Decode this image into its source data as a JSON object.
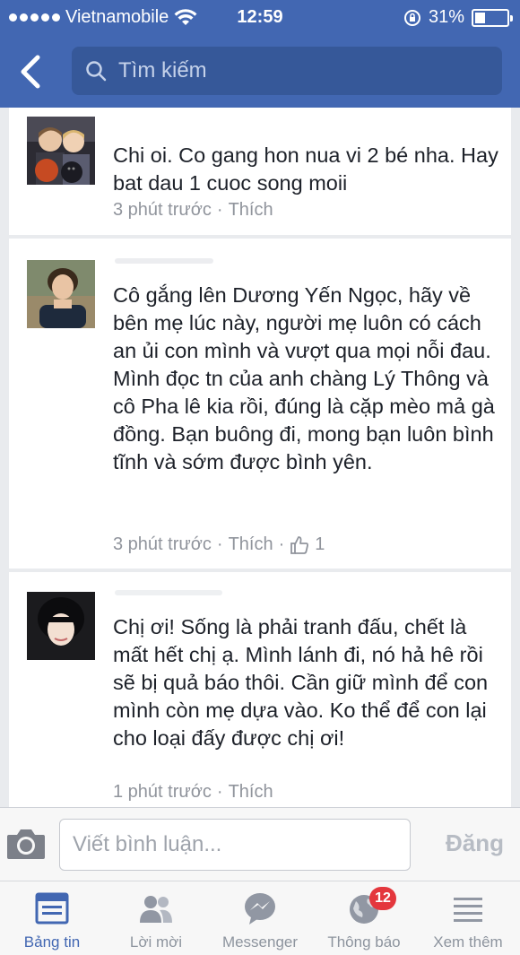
{
  "status_bar": {
    "carrier": "Vietnamobile",
    "time": "12:59",
    "battery_text": "31%",
    "battery_level": 0.31
  },
  "nav": {
    "back_icon": "chevron-left-icon",
    "search_placeholder": "Tìm kiếm"
  },
  "comments": [
    {
      "text": "Chi oi. Co gang hon nua vi 2 bé nha. Hay bat dau 1 cuoc song moii",
      "time": "3 phút trước",
      "like_label": "Thích",
      "likes": ""
    },
    {
      "text": "Cô gắng lên Dương Yến Ngọc, hãy về bên mẹ lúc này, người mẹ luôn có cách an ủi con mình và vượt qua mọi nỗi đau. Mình đọc tn của anh chàng Lý Thông và cô Pha lê kia rồi, đúng là cặp mèo mả gà đồng. Bạn buông đi, mong bạn luôn bình tĩnh và sớm được bình yên.",
      "time": "3 phút trước",
      "like_label": "Thích",
      "likes": "1"
    },
    {
      "text": "Chị ơi! Sống là phải tranh đấu, chết là mất hết chị ạ. Mình lánh đi, nó hả hê rồi sẽ bị quả báo thôi. Cần giữ mình để con mình còn mẹ dựa vào. Ko thể để con lại cho loại  đấy được chị ơi!",
      "time": "1 phút trước",
      "like_label": "Thích",
      "likes": ""
    }
  ],
  "composer": {
    "placeholder": "Viết bình luận...",
    "post_label": "Đăng"
  },
  "tabs": [
    {
      "label": "Bảng tin",
      "icon": "news-feed-icon",
      "active": true
    },
    {
      "label": "Lời mời",
      "icon": "friend-requests-icon",
      "active": false
    },
    {
      "label": "Messenger",
      "icon": "messenger-icon",
      "active": false
    },
    {
      "label": "Thông báo",
      "icon": "globe-icon",
      "active": false,
      "badge": "12"
    },
    {
      "label": "Xem thêm",
      "icon": "menu-icon",
      "active": false
    }
  ],
  "colors": {
    "brand": "#4267b2",
    "meta_gray": "#90949c",
    "badge_red": "#e4373d"
  }
}
